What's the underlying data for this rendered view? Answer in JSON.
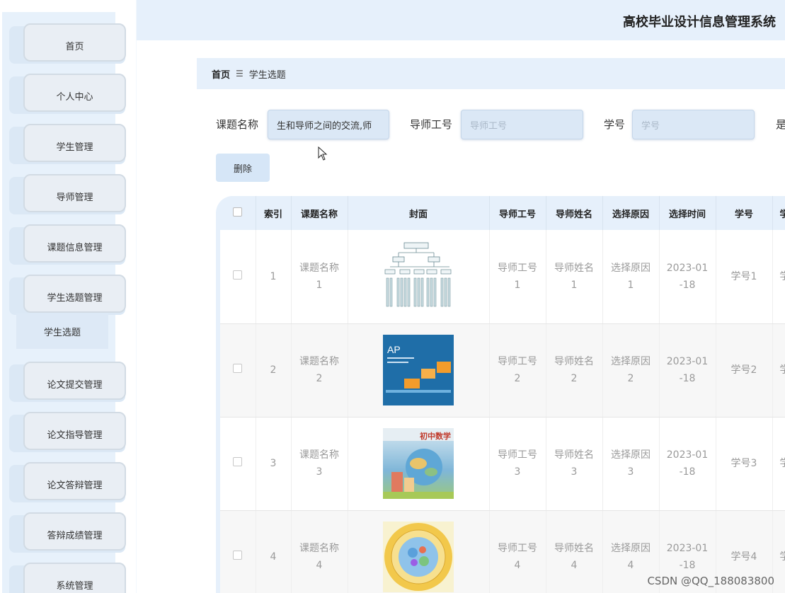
{
  "header": {
    "title": "高校毕业设计信息管理系统"
  },
  "sidebar": {
    "items": [
      {
        "label": "首页"
      },
      {
        "label": "个人中心"
      },
      {
        "label": "学生管理"
      },
      {
        "label": "导师管理"
      },
      {
        "label": "课题信息管理"
      },
      {
        "label": "学生选题管理"
      },
      {
        "label": "论文提交管理"
      },
      {
        "label": "论文指导管理"
      },
      {
        "label": "论文答辩管理"
      },
      {
        "label": "答辩成绩管理"
      },
      {
        "label": "系统管理"
      }
    ],
    "submenu_label": "学生选题"
  },
  "breadcrumb": {
    "home": "首页",
    "separator": "☰",
    "current": "学生选题"
  },
  "search": {
    "topic_label": "课题名称",
    "topic_value": "生和导师之间的交流,师",
    "tutor_id_label": "导师工号",
    "tutor_id_placeholder": "导师工号",
    "student_id_label": "学号",
    "student_id_placeholder": "学号",
    "extra_label": "是"
  },
  "toolbar": {
    "delete_label": "删除"
  },
  "table": {
    "headers": [
      "",
      "索引",
      "课题名称",
      "封面",
      "导师工号",
      "导师姓名",
      "选择原因",
      "选择时间",
      "学号",
      "学"
    ],
    "rows": [
      {
        "index": "1",
        "topic_a": "课题名称",
        "topic_b": "1",
        "tid_a": "导师工号",
        "tid_b": "1",
        "tname_a": "导师姓名",
        "tname_b": "1",
        "reason_a": "选择原因",
        "reason_b": "1",
        "time_a": "2023-01",
        "time_b": "-18",
        "sid": "学号1",
        "extra": "学"
      },
      {
        "index": "2",
        "topic_a": "课题名称",
        "topic_b": "2",
        "tid_a": "导师工号",
        "tid_b": "2",
        "tname_a": "导师姓名",
        "tname_b": "2",
        "reason_a": "选择原因",
        "reason_b": "2",
        "time_a": "2023-01",
        "time_b": "-18",
        "sid": "学号2",
        "extra": "学"
      },
      {
        "index": "3",
        "topic_a": "课题名称",
        "topic_b": "3",
        "tid_a": "导师工号",
        "tid_b": "3",
        "tname_a": "导师姓名",
        "tname_b": "3",
        "reason_a": "选择原因",
        "reason_b": "3",
        "time_a": "2023-01",
        "time_b": "-18",
        "sid": "学号3",
        "extra": "学"
      },
      {
        "index": "4",
        "topic_a": "课题名称",
        "topic_b": "4",
        "tid_a": "导师工号",
        "tid_b": "4",
        "tname_a": "导师姓名",
        "tname_b": "4",
        "reason_a": "选择原因",
        "reason_b": "4",
        "time_a": "2023-01",
        "time_b": "-18",
        "sid": "学号4",
        "extra": "学"
      }
    ],
    "covers": [
      {
        "name": "tree-diagram-cover"
      },
      {
        "name": "ap-textbook-cover",
        "text": "AP"
      },
      {
        "name": "math-textbook-cover",
        "text": "初中数学"
      },
      {
        "name": "circle-poster-cover"
      }
    ]
  },
  "watermark": "CSDN @QQ_188083800",
  "colors": {
    "accent": "#e6f0fb",
    "button": "#d6e6f7",
    "input": "#dbe8f6"
  }
}
